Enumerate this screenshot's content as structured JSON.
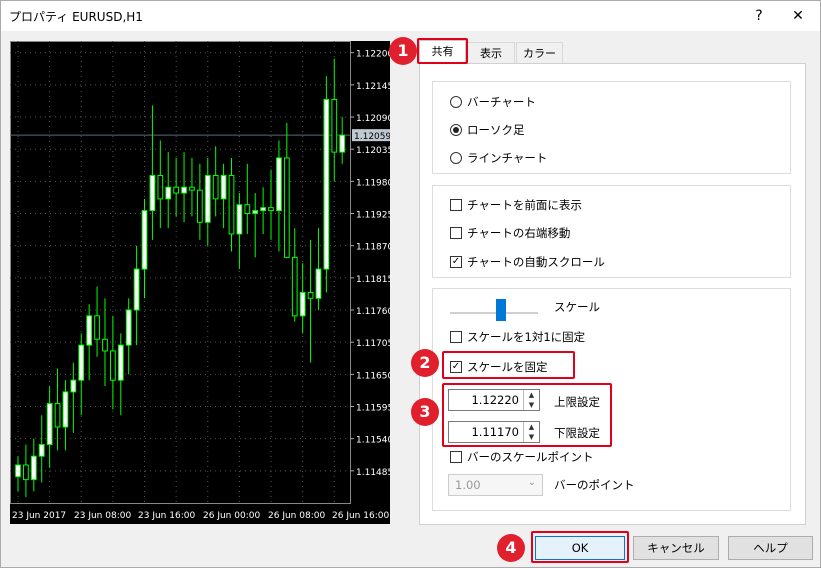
{
  "window": {
    "title": "プロパティ EURUSD,H1",
    "help": "?",
    "close": "✕"
  },
  "tabs": [
    "共有",
    "表示",
    "カラー"
  ],
  "chart_type": {
    "options": [
      {
        "label": "バーチャート",
        "checked": false
      },
      {
        "label": "ローソク足",
        "checked": true
      },
      {
        "label": "ラインチャート",
        "checked": false
      }
    ]
  },
  "display_options": [
    {
      "label": "チャートを前面に表示",
      "checked": false
    },
    {
      "label": "チャートの右端移動",
      "checked": false
    },
    {
      "label": "チャートの自動スクロール",
      "checked": true
    }
  ],
  "scale": {
    "label": "スケール",
    "fix_one_to_one": {
      "label": "スケールを1対1に固定",
      "checked": false
    },
    "fix_scale": {
      "label": "スケールを固定",
      "checked": true
    },
    "upper": {
      "value": "1.12220",
      "label": "上限設定"
    },
    "lower": {
      "value": "1.11170",
      "label": "下限設定"
    },
    "bar_scale_points": {
      "label": "バーのスケールポイント",
      "checked": false
    },
    "bar_points": {
      "value": "1.00",
      "label": "バーのポイント"
    }
  },
  "buttons": {
    "ok": "OK",
    "cancel": "キャンセル",
    "help": "ヘルプ"
  },
  "badges": [
    "1",
    "2",
    "3",
    "4"
  ],
  "chart_data": {
    "type": "candlestick",
    "symbol": "EURUSD,H1",
    "price_labels": [
      "1.12200",
      "1.12145",
      "1.12090",
      "1.12035",
      "1.11980",
      "1.11925",
      "1.11870",
      "1.11815",
      "1.11760",
      "1.11705",
      "1.11650",
      "1.11595",
      "1.11540",
      "1.11485"
    ],
    "current_price": "1.12059",
    "time_labels": [
      "23 Jun 2017",
      "23 Jun 08:00",
      "23 Jun 16:00",
      "26 Jun 00:00",
      "26 Jun 08:00",
      "26 Jun 16:00"
    ],
    "ylim": [
      1.1143,
      1.1222
    ],
    "colors": {
      "background": "#000000",
      "grid": "#555555",
      "bull_body": "#ffffff",
      "bear_body": "#000000",
      "outline": "#00ff00"
    },
    "candles": [
      {
        "o": 1.11475,
        "h": 1.1151,
        "l": 1.1145,
        "c": 1.11495
      },
      {
        "o": 1.11495,
        "h": 1.1153,
        "l": 1.1144,
        "c": 1.1147
      },
      {
        "o": 1.1147,
        "h": 1.1154,
        "l": 1.1145,
        "c": 1.1151
      },
      {
        "o": 1.1151,
        "h": 1.1158,
        "l": 1.11465,
        "c": 1.1153
      },
      {
        "o": 1.1153,
        "h": 1.1163,
        "l": 1.1149,
        "c": 1.116
      },
      {
        "o": 1.116,
        "h": 1.1166,
        "l": 1.1152,
        "c": 1.1156
      },
      {
        "o": 1.1156,
        "h": 1.1164,
        "l": 1.1152,
        "c": 1.1162
      },
      {
        "o": 1.1162,
        "h": 1.1167,
        "l": 1.1155,
        "c": 1.1164
      },
      {
        "o": 1.1164,
        "h": 1.1172,
        "l": 1.1158,
        "c": 1.117
      },
      {
        "o": 1.117,
        "h": 1.1177,
        "l": 1.1164,
        "c": 1.1175
      },
      {
        "o": 1.1175,
        "h": 1.118,
        "l": 1.1168,
        "c": 1.1171
      },
      {
        "o": 1.1171,
        "h": 1.1178,
        "l": 1.1163,
        "c": 1.1169
      },
      {
        "o": 1.1169,
        "h": 1.1175,
        "l": 1.1159,
        "c": 1.1164
      },
      {
        "o": 1.1164,
        "h": 1.1172,
        "l": 1.1158,
        "c": 1.117
      },
      {
        "o": 1.117,
        "h": 1.1178,
        "l": 1.1165,
        "c": 1.1176
      },
      {
        "o": 1.1176,
        "h": 1.1187,
        "l": 1.117,
        "c": 1.1183
      },
      {
        "o": 1.1183,
        "h": 1.1195,
        "l": 1.1178,
        "c": 1.1193
      },
      {
        "o": 1.1193,
        "h": 1.1211,
        "l": 1.1188,
        "c": 1.1199
      },
      {
        "o": 1.1199,
        "h": 1.1205,
        "l": 1.119,
        "c": 1.1195
      },
      {
        "o": 1.1195,
        "h": 1.1203,
        "l": 1.119,
        "c": 1.1197
      },
      {
        "o": 1.1197,
        "h": 1.1202,
        "l": 1.1192,
        "c": 1.1196
      },
      {
        "o": 1.1196,
        "h": 1.1203,
        "l": 1.1191,
        "c": 1.1197
      },
      {
        "o": 1.1197,
        "h": 1.1202,
        "l": 1.1192,
        "c": 1.11965
      },
      {
        "o": 1.11965,
        "h": 1.1201,
        "l": 1.1188,
        "c": 1.1191
      },
      {
        "o": 1.1191,
        "h": 1.1202,
        "l": 1.1187,
        "c": 1.1199
      },
      {
        "o": 1.1199,
        "h": 1.1204,
        "l": 1.1192,
        "c": 1.1195
      },
      {
        "o": 1.1195,
        "h": 1.1201,
        "l": 1.119,
        "c": 1.1199
      },
      {
        "o": 1.1199,
        "h": 1.1202,
        "l": 1.1186,
        "c": 1.1189
      },
      {
        "o": 1.1189,
        "h": 1.1196,
        "l": 1.1183,
        "c": 1.1194
      },
      {
        "o": 1.1194,
        "h": 1.1201,
        "l": 1.1189,
        "c": 1.11925
      },
      {
        "o": 1.11925,
        "h": 1.1196,
        "l": 1.1185,
        "c": 1.1193
      },
      {
        "o": 1.1193,
        "h": 1.1197,
        "l": 1.1189,
        "c": 1.11935
      },
      {
        "o": 1.11935,
        "h": 1.12,
        "l": 1.1188,
        "c": 1.1193
      },
      {
        "o": 1.1193,
        "h": 1.1205,
        "l": 1.1186,
        "c": 1.1202
      },
      {
        "o": 1.1202,
        "h": 1.1208,
        "l": 1.1185,
        "c": 1.1185
      },
      {
        "o": 1.1185,
        "h": 1.119,
        "l": 1.1174,
        "c": 1.1175
      },
      {
        "o": 1.1175,
        "h": 1.1184,
        "l": 1.1172,
        "c": 1.1179
      },
      {
        "o": 1.1179,
        "h": 1.1188,
        "l": 1.1167,
        "c": 1.1178
      },
      {
        "o": 1.1178,
        "h": 1.119,
        "l": 1.1176,
        "c": 1.1183
      },
      {
        "o": 1.1183,
        "h": 1.1216,
        "l": 1.1179,
        "c": 1.1212
      },
      {
        "o": 1.1212,
        "h": 1.1219,
        "l": 1.1198,
        "c": 1.1203
      },
      {
        "o": 1.1203,
        "h": 1.1209,
        "l": 1.1201,
        "c": 1.12059
      }
    ]
  }
}
